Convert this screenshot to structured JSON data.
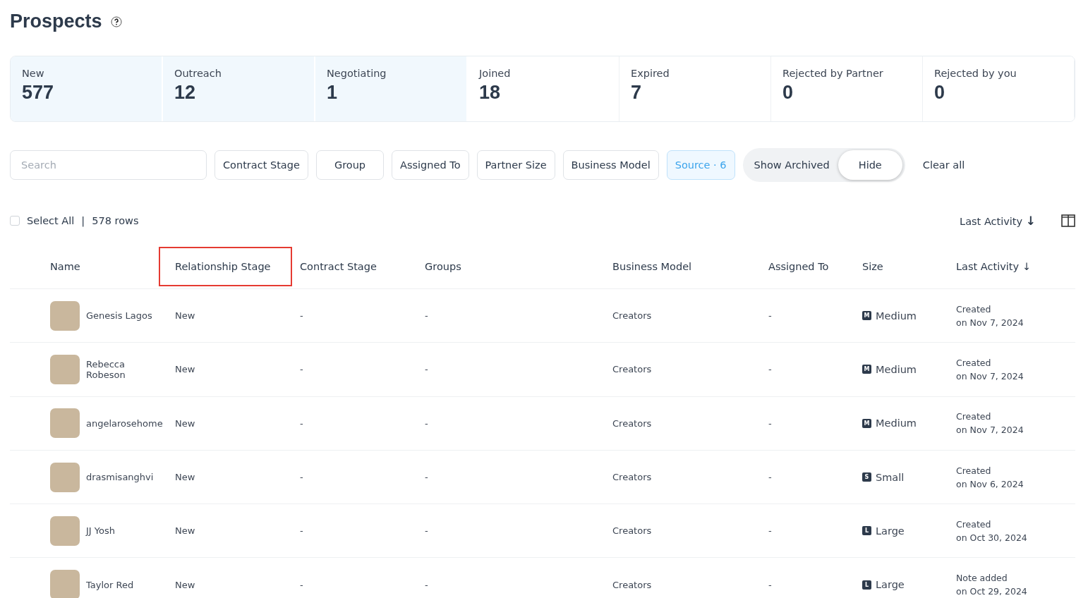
{
  "page": {
    "title": "Prospects"
  },
  "stages": [
    {
      "label": "New",
      "count": "577",
      "selected": true
    },
    {
      "label": "Outreach",
      "count": "12",
      "selected": true
    },
    {
      "label": "Negotiating",
      "count": "1",
      "selected": true
    },
    {
      "label": "Joined",
      "count": "18",
      "selected": false
    },
    {
      "label": "Expired",
      "count": "7",
      "selected": false
    },
    {
      "label": "Rejected by Partner",
      "count": "0",
      "selected": false
    },
    {
      "label": "Rejected by you",
      "count": "0",
      "selected": false
    }
  ],
  "search": {
    "placeholder": "Search"
  },
  "filters": [
    {
      "label": "Contract Stage",
      "selected": false
    },
    {
      "label": "Group",
      "selected": false
    },
    {
      "label": "Assigned To",
      "selected": false
    },
    {
      "label": "Partner Size",
      "selected": false
    },
    {
      "label": "Business Model",
      "selected": false
    },
    {
      "label": "Source · 6",
      "selected": true
    }
  ],
  "archived_toggle": {
    "label": "Show Archived",
    "options": [
      {
        "label": "Hide",
        "selected": true
      }
    ]
  },
  "clear_all": "Clear all",
  "selection": {
    "label": "Select All",
    "checked": false,
    "separator": "|",
    "count": "578",
    "count_unit": "rows"
  },
  "sort": {
    "label": "Last Activity",
    "arrow": "↓"
  },
  "table": {
    "columns": [
      {
        "label": "Name",
        "highlighted": false
      },
      {
        "label": "Relationship Stage",
        "highlighted": true
      },
      {
        "label": "Contract Stage",
        "highlighted": false
      },
      {
        "label": "Groups",
        "highlighted": false
      },
      {
        "label": "Business Model",
        "highlighted": false
      },
      {
        "label": "Assigned To",
        "highlighted": false
      },
      {
        "label": "Size",
        "highlighted": false
      },
      {
        "label": "Last Activity ↓",
        "highlighted": false
      }
    ],
    "rows": [
      {
        "name": "Genesis Lagos",
        "stage": "New",
        "contract": "-",
        "groups": "-",
        "model": "Creators",
        "assigned": "-",
        "size_badge": "M",
        "size": "Medium",
        "activity": "Created",
        "date": "on Nov 7, 2024"
      },
      {
        "name": "Rebecca Robeson",
        "stage": "New",
        "contract": "-",
        "groups": "-",
        "model": "Creators",
        "assigned": "-",
        "size_badge": "M",
        "size": "Medium",
        "activity": "Created",
        "date": "on Nov 7, 2024"
      },
      {
        "name": "angelarosehome",
        "stage": "New",
        "contract": "-",
        "groups": "-",
        "model": "Creators",
        "assigned": "-",
        "size_badge": "M",
        "size": "Medium",
        "activity": "Created",
        "date": "on Nov 7, 2024"
      },
      {
        "name": "drasmisanghvi",
        "stage": "New",
        "contract": "-",
        "groups": "-",
        "model": "Creators",
        "assigned": "-",
        "size_badge": "S",
        "size": "Small",
        "activity": "Created",
        "date": "on Nov 6, 2024"
      },
      {
        "name": "JJ Yosh",
        "stage": "New",
        "contract": "-",
        "groups": "-",
        "model": "Creators",
        "assigned": "-",
        "size_badge": "L",
        "size": "Large",
        "activity": "Created",
        "date": "on Oct 30, 2024"
      },
      {
        "name": "Taylor Red",
        "stage": "New",
        "contract": "-",
        "groups": "-",
        "model": "Creators",
        "assigned": "-",
        "size_badge": "L",
        "size": "Large",
        "activity": "Note added",
        "date": "on Oct 29, 2024"
      }
    ]
  }
}
